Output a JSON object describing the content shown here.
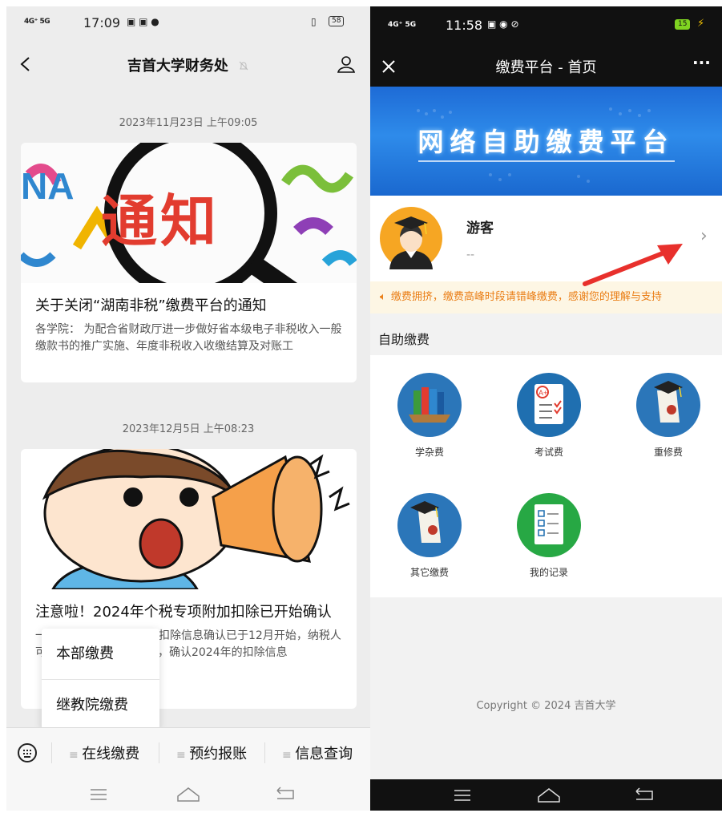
{
  "left": {
    "status": {
      "signal": "4G⁺ 5G",
      "time": "17:09",
      "battery": "58"
    },
    "nav": {
      "title": "吉首大学财务处"
    },
    "messages": [
      {
        "date": "2023年11月23日 上午09:05",
        "image_text": "通知",
        "title": "关于关闭“湖南非税”缴费平台的通知",
        "desc": "各学院：   为配合省财政厅进一步做好省本级电子非税收入一般缴款书的推广实施、年度非税收入收缴结算及对账工"
      },
      {
        "date": "2023年12月5日 上午08:23",
        "title": "注意啦！2024年个税专项附加扣除已开始确认",
        "desc": "一年一度的个税专项附加扣除信息确认已于12月开始，纳税人可通过“个人所得税”APP，确认2024年的扣除信息"
      }
    ],
    "popup": {
      "items": [
        "本部缴费",
        "继教院缴费"
      ]
    },
    "menu": {
      "items": [
        "在线缴费",
        "预约报账",
        "信息查询"
      ]
    }
  },
  "right": {
    "status": {
      "signal": "4G⁺ 5G",
      "time": "11:58",
      "battery": "15"
    },
    "nav": {
      "title": "缴费平台 - 首页",
      "more": "···"
    },
    "banner": {
      "text": "网络自助缴费平台"
    },
    "profile": {
      "name": "游客",
      "sub": "--"
    },
    "notice": {
      "text": "缴费拥挤，缴费高峰时段请错峰缴费，感谢您的理解与支持"
    },
    "section_title": "自助缴费",
    "services": [
      {
        "label": "学杂费",
        "icon": "books-icon",
        "color": "#2b76b9"
      },
      {
        "label": "考试费",
        "icon": "exam-icon",
        "color": "#1f6fb0"
      },
      {
        "label": "重修费",
        "icon": "diploma-icon",
        "color": "#2b76b9"
      },
      {
        "label": "其它缴费",
        "icon": "diploma-cap-icon",
        "color": "#2b76b9"
      },
      {
        "label": "我的记录",
        "icon": "records-icon",
        "color": "#27a844"
      }
    ],
    "copyright": "Copyright © 2024  吉首大学"
  },
  "annotation": {
    "color": "#e8302c"
  }
}
